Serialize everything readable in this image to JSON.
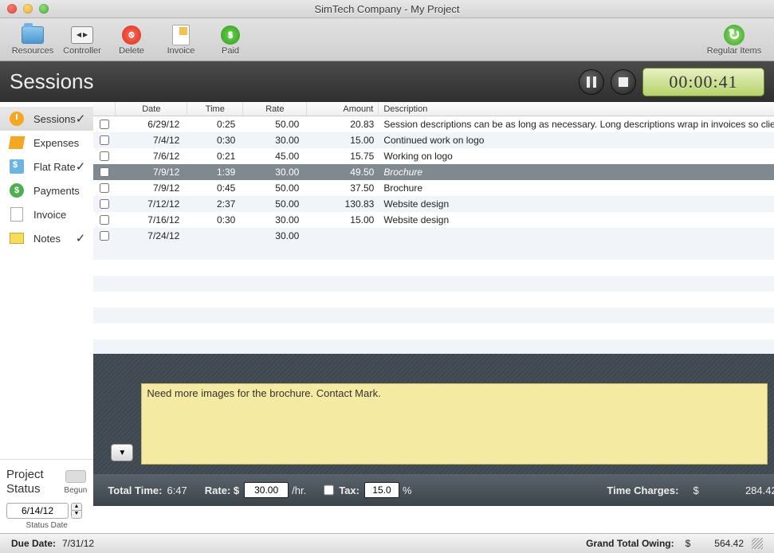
{
  "window_title": "SimTech Company - My Project",
  "toolbar": {
    "resources": "Resources",
    "controller": "Controller",
    "delete": "Delete",
    "invoice": "Invoice",
    "paid": "Paid",
    "regular_items": "Regular Items"
  },
  "header": {
    "title": "Sessions",
    "timer": "00:00:41"
  },
  "sidebar": {
    "items": [
      {
        "label": "Sessions",
        "checked": true
      },
      {
        "label": "Expenses",
        "checked": false
      },
      {
        "label": "Flat Rate",
        "checked": true
      },
      {
        "label": "Payments",
        "checked": false
      },
      {
        "label": "Invoice",
        "checked": false
      },
      {
        "label": "Notes",
        "checked": true
      }
    ],
    "project_status_label": "Project\nStatus",
    "begun_label": "Begun",
    "status_date": "6/14/12",
    "status_date_label": "Status Date"
  },
  "table": {
    "headers": {
      "date": "Date",
      "time": "Time",
      "rate": "Rate",
      "amount": "Amount",
      "description": "Description"
    },
    "rows": [
      {
        "date": "6/29/12",
        "time": "0:25",
        "rate": "50.00",
        "amount": "20.83",
        "desc": "Session descriptions can be as long as necessary. Long descriptions wrap in invoices so client..."
      },
      {
        "date": "7/4/12",
        "time": "0:30",
        "rate": "30.00",
        "amount": "15.00",
        "desc": "Continued work on logo"
      },
      {
        "date": "7/6/12",
        "time": "0:21",
        "rate": "45.00",
        "amount": "15.75",
        "desc": "Working on logo"
      },
      {
        "date": "7/9/12",
        "time": "1:39",
        "rate": "30.00",
        "amount": "49.50",
        "desc": "Brochure",
        "selected": true
      },
      {
        "date": "7/9/12",
        "time": "0:45",
        "rate": "50.00",
        "amount": "37.50",
        "desc": "Brochure"
      },
      {
        "date": "7/12/12",
        "time": "2:37",
        "rate": "50.00",
        "amount": "130.83",
        "desc": "Website design"
      },
      {
        "date": "7/16/12",
        "time": "0:30",
        "rate": "30.00",
        "amount": "15.00",
        "desc": "Website design"
      },
      {
        "date": "7/24/12",
        "time": "",
        "rate": "30.00",
        "amount": "",
        "desc": ""
      }
    ]
  },
  "note_text": "Need more images for the brochure. Contact Mark.",
  "summary": {
    "total_time_label": "Total Time:",
    "total_time": "6:47",
    "rate_label": "Rate: $",
    "rate_value": "30.00",
    "rate_suffix": "/hr.",
    "tax_label": "Tax:",
    "tax_value": "15.0",
    "tax_suffix": "%",
    "time_charges_label": "Time Charges:",
    "currency": "$",
    "time_charges": "284.42"
  },
  "footer": {
    "due_label": "Due Date:",
    "due_date": "7/31/12",
    "grand_label": "Grand Total Owing:",
    "currency": "$",
    "grand_total": "564.42"
  }
}
